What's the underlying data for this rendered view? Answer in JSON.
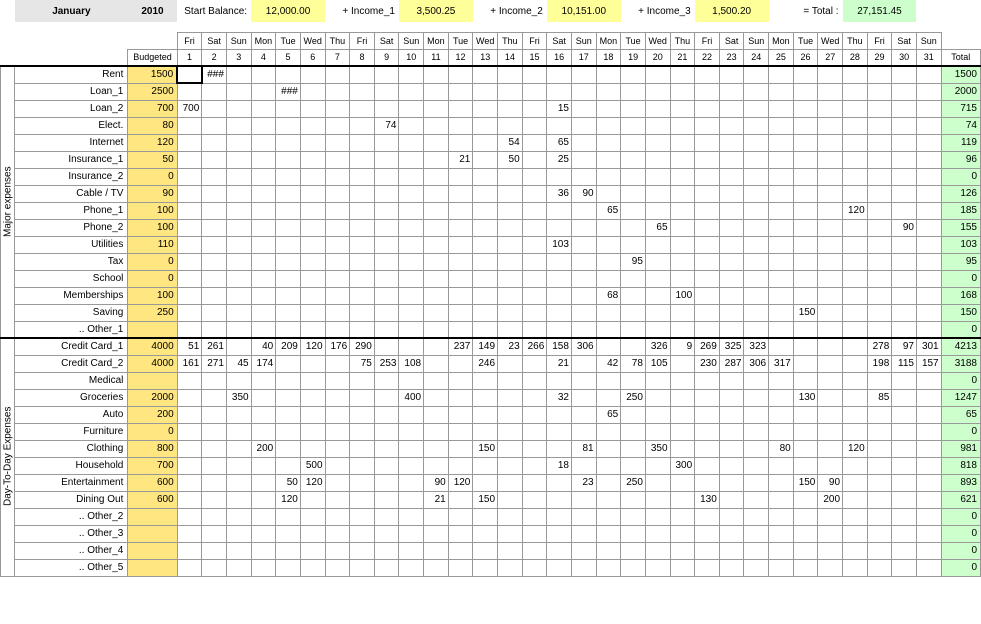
{
  "header": {
    "month": "January",
    "year": "2010",
    "start_balance_label": "Start Balance:",
    "start_balance": "12,000.00",
    "income1_label": "+ Income_1",
    "income1": "3,500.25",
    "income2_label": "+ Income_2",
    "income2": "10,151.00",
    "income3_label": "+ Income_3",
    "income3": "1,500.20",
    "total_label": "= Total :",
    "total": "27,151.45"
  },
  "columns": {
    "budgeted_label": "Budgeted",
    "total_label": "Total",
    "weekdays": [
      "Fri",
      "Sat",
      "Sun",
      "Mon",
      "Tue",
      "Wed",
      "Thu",
      "Fri",
      "Sat",
      "Sun",
      "Mon",
      "Tue",
      "Wed",
      "Thu",
      "Fri",
      "Sat",
      "Sun",
      "Mon",
      "Tue",
      "Wed",
      "Thu",
      "Fri",
      "Sat",
      "Sun",
      "Mon",
      "Tue",
      "Wed",
      "Thu",
      "Fri",
      "Sat",
      "Sun"
    ],
    "days": [
      "1",
      "2",
      "3",
      "4",
      "5",
      "6",
      "7",
      "8",
      "9",
      "10",
      "11",
      "12",
      "13",
      "14",
      "15",
      "16",
      "17",
      "18",
      "19",
      "20",
      "21",
      "22",
      "23",
      "24",
      "25",
      "26",
      "27",
      "28",
      "29",
      "30",
      "31"
    ]
  },
  "sections": {
    "major": "Major expenses",
    "daily": "Day-To-Day Expenses"
  },
  "rows": [
    {
      "sec": "major",
      "label": "Rent",
      "budget": "1500",
      "days": {
        "2": "###"
      },
      "total": "1500"
    },
    {
      "sec": "major",
      "label": "Loan_1",
      "budget": "2500",
      "days": {
        "5": "###"
      },
      "total": "2000"
    },
    {
      "sec": "major",
      "label": "Loan_2",
      "budget": "700",
      "days": {
        "1": "700",
        "16": "15"
      },
      "total": "715"
    },
    {
      "sec": "major",
      "label": "Elect.",
      "budget": "80",
      "days": {
        "9": "74"
      },
      "total": "74"
    },
    {
      "sec": "major",
      "label": "Internet",
      "budget": "120",
      "days": {
        "14": "54",
        "16": "65"
      },
      "total": "119"
    },
    {
      "sec": "major",
      "label": "Insurance_1",
      "budget": "50",
      "days": {
        "12": "21",
        "14": "50",
        "16": "25"
      },
      "total": "96"
    },
    {
      "sec": "major",
      "label": "Insurance_2",
      "budget": "0",
      "days": {},
      "total": "0"
    },
    {
      "sec": "major",
      "label": "Cable / TV",
      "budget": "90",
      "days": {
        "16": "36",
        "17": "90"
      },
      "total": "126"
    },
    {
      "sec": "major",
      "label": "Phone_1",
      "budget": "100",
      "days": {
        "18": "65",
        "28": "120"
      },
      "total": "185"
    },
    {
      "sec": "major",
      "label": "Phone_2",
      "budget": "100",
      "days": {
        "20": "65",
        "30": "90"
      },
      "total": "155"
    },
    {
      "sec": "major",
      "label": "Utilities",
      "budget": "110",
      "days": {
        "16": "103"
      },
      "total": "103"
    },
    {
      "sec": "major",
      "label": "Tax",
      "budget": "0",
      "days": {
        "19": "95"
      },
      "total": "95"
    },
    {
      "sec": "major",
      "label": "School",
      "budget": "0",
      "days": {},
      "total": "0"
    },
    {
      "sec": "major",
      "label": "Memberships",
      "budget": "100",
      "days": {
        "18": "68",
        "21": "100"
      },
      "total": "168"
    },
    {
      "sec": "major",
      "label": "Saving",
      "budget": "250",
      "days": {
        "26": "150"
      },
      "total": "150"
    },
    {
      "sec": "major",
      "label": ".. Other_1",
      "budget": "",
      "days": {},
      "total": "0"
    },
    {
      "sec": "daily",
      "label": "Credit Card_1",
      "budget": "4000",
      "days": {
        "1": "51",
        "2": "261",
        "4": "40",
        "5": "209",
        "6": "120",
        "7": "176",
        "8": "290",
        "12": "237",
        "13": "149",
        "14": "23",
        "15": "266",
        "16": "158",
        "17": "306",
        "20": "326",
        "21": "9",
        "22": "269",
        "23": "325",
        "24": "323",
        "29": "278",
        "30": "97",
        "31": "301"
      },
      "total": "4213"
    },
    {
      "sec": "daily",
      "label": "Credit Card_2",
      "budget": "4000",
      "days": {
        "1": "161",
        "2": "271",
        "3": "45",
        "4": "174",
        "8": "75",
        "9": "253",
        "10": "108",
        "13": "246",
        "16": "21",
        "18": "42",
        "19": "78",
        "20": "105",
        "22": "230",
        "23": "287",
        "24": "306",
        "25": "317",
        "29": "198",
        "30": "115",
        "31": "157"
      },
      "total": "3188"
    },
    {
      "sec": "daily",
      "label": "Medical",
      "budget": "",
      "days": {},
      "total": "0"
    },
    {
      "sec": "daily",
      "label": "Groceries",
      "budget": "2000",
      "days": {
        "3": "350",
        "10": "400",
        "16": "32",
        "19": "250",
        "26": "130",
        "29": "85"
      },
      "total": "1247"
    },
    {
      "sec": "daily",
      "label": "Auto",
      "budget": "200",
      "days": {
        "18": "65"
      },
      "total": "65"
    },
    {
      "sec": "daily",
      "label": "Furniture",
      "budget": "0",
      "days": {},
      "total": "0"
    },
    {
      "sec": "daily",
      "label": "Clothing",
      "budget": "800",
      "days": {
        "4": "200",
        "13": "150",
        "17": "81",
        "20": "350",
        "25": "80",
        "28": "120"
      },
      "total": "981"
    },
    {
      "sec": "daily",
      "label": "Household",
      "budget": "700",
      "days": {
        "6": "500",
        "16": "18",
        "21": "300"
      },
      "total": "818"
    },
    {
      "sec": "daily",
      "label": "Entertainment",
      "budget": "600",
      "days": {
        "5": "50",
        "6": "120",
        "11": "90",
        "12": "120",
        "17": "23",
        "19": "250",
        "26": "150",
        "27": "90"
      },
      "total": "893"
    },
    {
      "sec": "daily",
      "label": "Dining Out",
      "budget": "600",
      "days": {
        "5": "120",
        "11": "21",
        "13": "150",
        "22": "130",
        "27": "200"
      },
      "total": "621"
    },
    {
      "sec": "daily",
      "label": ".. Other_2",
      "budget": "",
      "days": {},
      "total": "0"
    },
    {
      "sec": "daily",
      "label": ".. Other_3",
      "budget": "",
      "days": {},
      "total": "0"
    },
    {
      "sec": "daily",
      "label": ".. Other_4",
      "budget": "",
      "days": {},
      "total": "0"
    },
    {
      "sec": "daily",
      "label": ".. Other_5",
      "budget": "",
      "days": {},
      "total": "0"
    }
  ]
}
